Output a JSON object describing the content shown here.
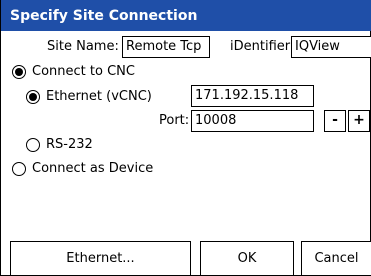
{
  "window": {
    "title": "Specify Site Connection"
  },
  "site": {
    "name_label": "Site Name:",
    "name_value": "Remote Tcp",
    "identifier_label": "iDentifier:",
    "identifier_value": "IQView"
  },
  "options": {
    "connect_cnc": "Connect to CNC",
    "ethernet": "Ethernet (vCNC)",
    "ip_value": "171.192.15.118",
    "port_label": "Port:",
    "port_value": "10008",
    "minus": "-",
    "plus": "+",
    "rs232": "RS-232",
    "connect_device": "Connect as Device"
  },
  "buttons": {
    "ethernet": "Ethernet...",
    "ok": "OK",
    "cancel": "Cancel"
  }
}
